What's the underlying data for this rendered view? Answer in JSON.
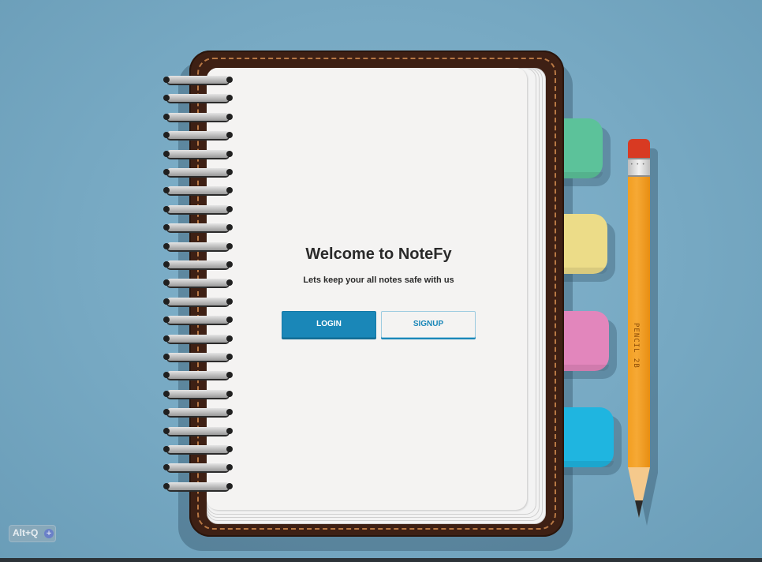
{
  "app": {
    "name": "NoteFy"
  },
  "welcome": {
    "title": "Welcome to NoteFy",
    "subtitle": "Lets keep your all notes safe with us"
  },
  "buttons": {
    "login_label": "LOGIN",
    "signup_label": "SIGNUP"
  },
  "pencil": {
    "label": "PENCIL 2B"
  },
  "shortcut": {
    "label": "Alt+Q",
    "icon": "plus-icon"
  },
  "colors": {
    "background": "#77a9c3",
    "cover": "#3e2014",
    "stitch": "#b87844",
    "page": "#f4f3f2",
    "accent": "#1a87b8",
    "tab_green": "#5cc29a",
    "tab_yellow": "#ecdc88",
    "tab_pink": "#e286bc",
    "tab_blue": "#1fb5e0",
    "pencil_body": "#f29e21",
    "pencil_eraser": "#d83a22"
  }
}
